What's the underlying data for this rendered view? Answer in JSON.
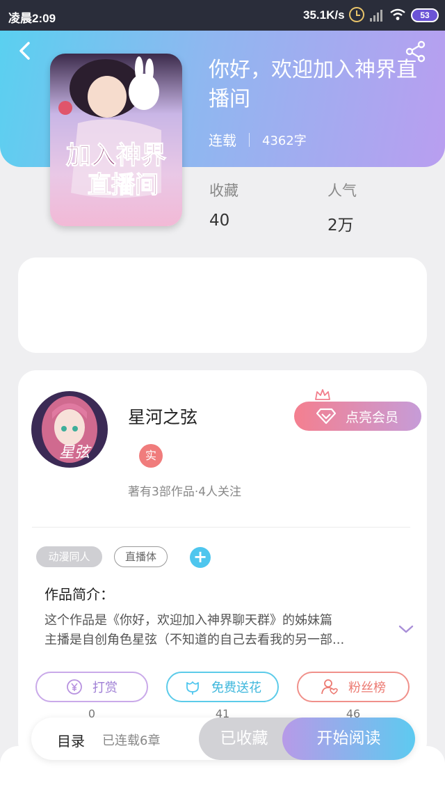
{
  "status_bar": {
    "time": "凌晨2:09",
    "speed": "35.1K/s",
    "battery": "53",
    "icons": [
      "alarm-icon",
      "signal-icon",
      "wifi-icon",
      "battery-icon"
    ]
  },
  "header": {
    "back_icon": "back-chevron-icon",
    "share_icon": "share-icon"
  },
  "book": {
    "cover_title_line1": "加入神界",
    "cover_title_line2": "直播间",
    "title": "你好，欢迎加入神界直播间",
    "status": "连载",
    "word_count": "4362字",
    "favorites_label": "收藏",
    "favorites_value": "40",
    "popularity_label": "人气",
    "popularity_value": "2万"
  },
  "author": {
    "name": "星河之弦",
    "verified_badge": "实",
    "stats": "著有3部作品·4人关注",
    "vip_button": "点亮会员",
    "avatar_text": "星弦"
  },
  "tags": [
    "动漫同人",
    "直播体"
  ],
  "intro": {
    "title": "作品简介：",
    "line1": "这个作品是《你好，欢迎加入神界聊天群》的姊妹篇",
    "line2": "主播是自创角色星弦（不知道的自己去看我的另一部..."
  },
  "actions": [
    {
      "label": "打赏",
      "count": "0",
      "icon": "yen-coin-icon"
    },
    {
      "label": "免费送花",
      "count": "41",
      "icon": "flower-icon"
    },
    {
      "label": "粉丝榜",
      "count": "46",
      "icon": "fans-icon"
    }
  ],
  "bottom_bar": {
    "toc": "目录",
    "chapters": "已连载6章",
    "collected": "已收藏",
    "read": "开始阅读"
  },
  "colors": {
    "accent_blue": "#5ad0f0",
    "accent_purple": "#b99ef0",
    "vip_pink": "#f47f8f"
  }
}
